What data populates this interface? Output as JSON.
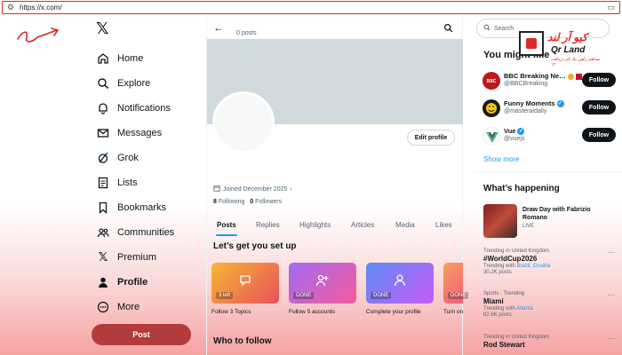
{
  "browser": {
    "url": "https://x.com/"
  },
  "sidebar": {
    "items": [
      {
        "label": "Home",
        "icon": "home-icon"
      },
      {
        "label": "Explore",
        "icon": "search-icon"
      },
      {
        "label": "Notifications",
        "icon": "bell-icon"
      },
      {
        "label": "Messages",
        "icon": "envelope-icon"
      },
      {
        "label": "Grok",
        "icon": "grok-icon"
      },
      {
        "label": "Lists",
        "icon": "list-icon"
      },
      {
        "label": "Bookmarks",
        "icon": "bookmark-icon"
      },
      {
        "label": "Communities",
        "icon": "people-icon"
      },
      {
        "label": "Premium",
        "icon": "x-icon"
      },
      {
        "label": "Profile",
        "icon": "person-icon"
      },
      {
        "label": "More",
        "icon": "more-icon"
      }
    ],
    "post_label": "Post"
  },
  "profile": {
    "post_count": "0 posts",
    "edit_label": "Edit profile",
    "joined": "Joined December 2025",
    "following_count": "8",
    "following_label": "Following",
    "followers_count": "0",
    "followers_label": "Followers"
  },
  "tabs": [
    "Posts",
    "Replies",
    "Highlights",
    "Articles",
    "Media",
    "Likes"
  ],
  "setup": {
    "title": "Let’s get you set up",
    "cards": [
      {
        "badge": "3 left",
        "label": "Follow 3 Topics",
        "color_from": "#f7b733",
        "color_to": "#e8505b"
      },
      {
        "badge": "DONE",
        "label": "Follow 5 accounts",
        "color_from": "#a26bf5",
        "color_to": "#f55b9a"
      },
      {
        "badge": "DONE",
        "label": "Complete your profile",
        "color_from": "#5b8cf5",
        "color_to": "#c85bf5"
      },
      {
        "badge": "DONE",
        "label": "Turn on",
        "color_from": "#f5a25b",
        "color_to": "#f55b7a"
      }
    ]
  },
  "who_to_follow": "Who to follow",
  "right": {
    "search_placeholder": "Search",
    "may_know_title": "You might like",
    "accounts": [
      {
        "name": "BBC Breaking Ne…",
        "handle": "@BBCBreaking",
        "follow": "Follow",
        "avatar_color": "#bb1919"
      },
      {
        "name": "Funny Moments",
        "handle": "@masteraidaily",
        "follow": "Follow",
        "avatar_color": "#1a1a1a"
      },
      {
        "name": "Vue",
        "handle": "@vuejs",
        "follow": "Follow",
        "avatar_color": "#ffffff"
      }
    ],
    "show_more": "Show more",
    "happening_title": "What’s happening",
    "event": {
      "title": "Draw Day with Fabrizio Romano",
      "status": "LIVE"
    },
    "trends": [
      {
        "context": "Trending in United Kingdom",
        "name": "#WorldCup2026",
        "with": "Trending with",
        "with_links": "Brazil, Croatia",
        "posts": "30.2K posts"
      },
      {
        "context": "Sports · Trending",
        "name": "Miami",
        "with": "Trending with",
        "with_links": "Atlanta",
        "posts": "82.6K posts"
      },
      {
        "context": "Trending in United Kingdom",
        "name": "Rod Stewart",
        "with": "",
        "with_links": "",
        "posts": ""
      }
    ]
  },
  "watermark": {
    "line1": "كيو آر لند",
    "line2": "Qr Land",
    "line3": "بساهم راهي يك كم دريافت ١٢"
  },
  "colors": {
    "accent": "#1d9bf0",
    "post_button": "#b23c3c",
    "urlbar_border": "#e02828"
  }
}
